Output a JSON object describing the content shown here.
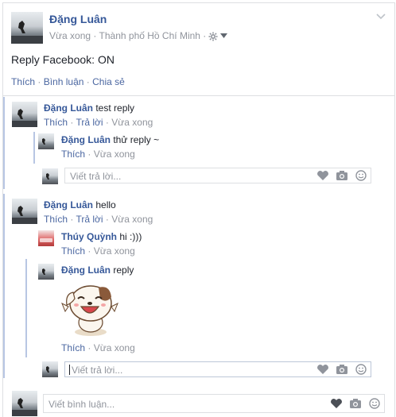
{
  "post": {
    "author": "Đặng Luân",
    "meta_time": "Vừa xong",
    "meta_location": "Thành phố Hồ Chí Minh",
    "text": "Reply Facebook: ON",
    "actions": {
      "like": "Thích",
      "comment": "Bình luận",
      "share": "Chia sẻ"
    }
  },
  "comments": [
    {
      "author": "Đặng Luân",
      "text": "test reply",
      "like": "Thích",
      "reply": "Trả lời",
      "time": "Vừa xong",
      "replies": [
        {
          "author": "Đặng Luân",
          "text": "thử reply ~",
          "like": "Thích",
          "time": "Vừa xong"
        }
      ],
      "reply_placeholder": "Viết trả lời..."
    },
    {
      "author": "Đặng Luân",
      "text": "hello",
      "like": "Thích",
      "reply": "Trả lời",
      "time": "Vừa xong",
      "replies": [
        {
          "author": "Thúy Quỳnh",
          "text": "hi :)))",
          "like": "Thích",
          "time": "Vừa xong"
        },
        {
          "author": "Đặng Luân",
          "text": "reply",
          "like": "Thích",
          "time": "Vừa xong",
          "sticker": "smiling-dog-sticker"
        }
      ],
      "reply_placeholder": "Viết trả lời..."
    }
  ],
  "comment_input": {
    "placeholder": "Viết bình luận..."
  },
  "icons": {
    "chevron": "chevron-down-icon",
    "privacy": "gear-icon",
    "sticker": "heart-sticker-icon",
    "camera": "camera-icon",
    "emoji": "emoji-icon"
  },
  "colors": {
    "name": "#365899",
    "link": "#4b67a1",
    "muted": "#90949c",
    "border": "#dddfe2"
  }
}
